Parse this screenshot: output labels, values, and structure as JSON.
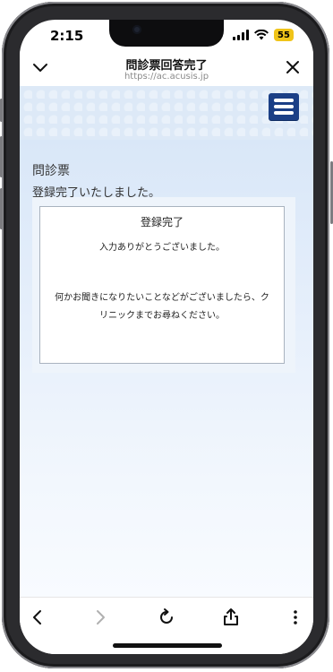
{
  "status_bar": {
    "time": "2:15",
    "battery": "55"
  },
  "browser": {
    "title": "問診票回答完了",
    "url": "https://ac.acusis.jp"
  },
  "page": {
    "section_title": "問診票",
    "section_subtitle": "登録完了いたしました。",
    "card": {
      "title": "登録完了",
      "line1": "入力ありがとうございました。",
      "line2": "何かお聞きになりたいことなどがございましたら、クリニックまでお尋ねください。"
    }
  },
  "icons": {
    "collapse": "chevron-down-icon",
    "close": "close-icon",
    "menu": "hamburger-menu-icon",
    "back": "back-arrow-icon",
    "forward": "forward-arrow-icon",
    "reload": "reload-icon",
    "share": "share-icon",
    "more": "more-vertical-icon"
  },
  "colors": {
    "menu_button": "#1b3f86",
    "battery": "#f0c419"
  }
}
